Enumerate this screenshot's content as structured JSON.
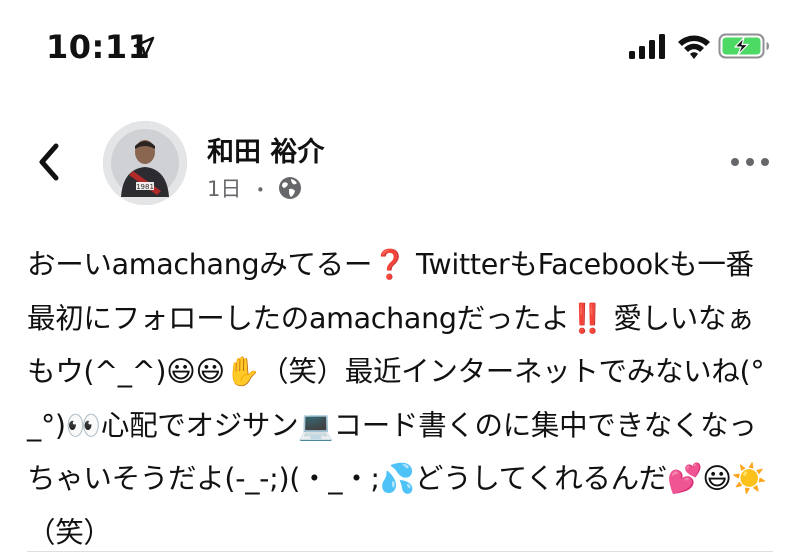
{
  "status_bar": {
    "time": "10:11",
    "battery_color": "#4cd964"
  },
  "post": {
    "author": "和田 裕介",
    "avatar_caption": "1981",
    "time": "1日",
    "separator": "・",
    "privacy_icon": "globe-icon",
    "text": "おーいamachangみてるー❓ TwitterもFacebookも一番最初にフォローしたのamachangだったよ‼️ 愛しいなぁもウ(^_^)😃😃✋（笑）最近インターネットでみないね(°_°)👀心配でオジサン💻コード書くのに集中できなくなっちゃいそうだよ(-_-;)(・_・;💦どうしてくれるんだ💕😃☀️（笑）"
  },
  "icons": {
    "back": "chevron-left-icon",
    "more": "more-dots-icon"
  }
}
